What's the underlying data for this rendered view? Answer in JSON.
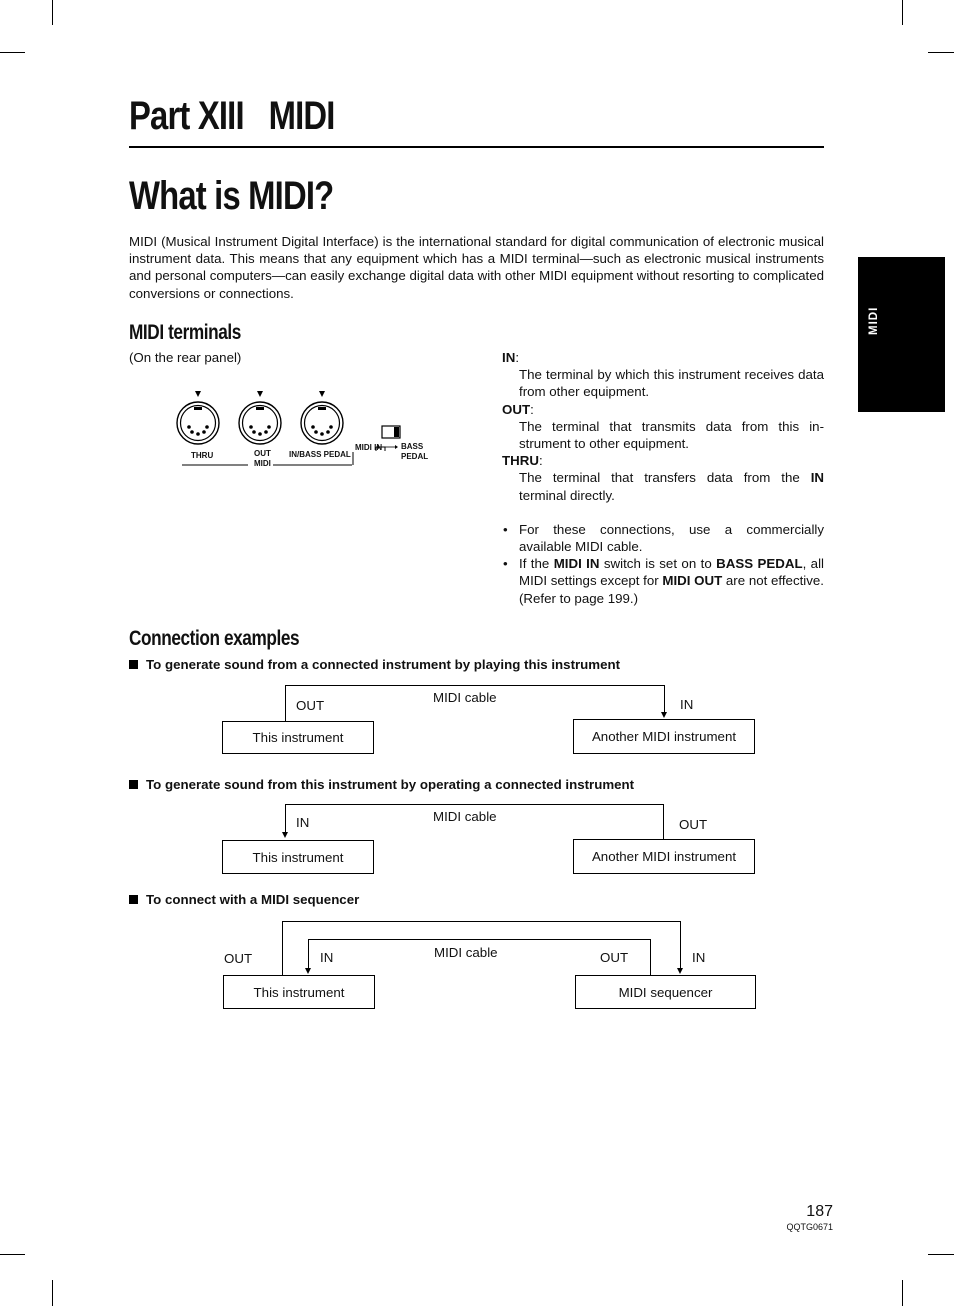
{
  "part_title": "Part XIII   MIDI",
  "page_title": "What is MIDI?",
  "intro": "MIDI (Musical Instrument Digital Interface) is the international standard for digital communication of electronic musical instrument data. This means that any equipment which has a MIDI terminal—such as electronic musical instruments and personal computers—can easily exchange digital data with other MIDI equipment without resorting to complicated conversions or connections.",
  "side_tab": "MIDI",
  "terminals": {
    "heading": "MIDI terminals",
    "caption": "(On the rear panel)",
    "panel": {
      "jack_labels": [
        "THRU",
        "OUT",
        "IN/BASS PEDAL"
      ],
      "group_label": "MIDI",
      "switch_left": "MIDI IN",
      "switch_right_1": "BASS",
      "switch_right_2": "PEDAL"
    },
    "definitions": [
      {
        "term": "IN",
        "text": "The terminal by which this instrument receives data from other equipment."
      },
      {
        "term": "OUT",
        "text": "The terminal that transmits data from this in-strument to other equipment."
      },
      {
        "term": "THRU",
        "text_before": "The terminal that transfers data from the ",
        "bold": "IN",
        "text_after": " terminal directly."
      }
    ],
    "notes": [
      {
        "text": "For these connections, use a commercially available MIDI cable."
      },
      {
        "p1": "If the ",
        "b1": "MIDI IN",
        "p2": " switch is set on to ",
        "b2": "BASS PEDAL",
        "p3": ", all MIDI settings except for ",
        "b3": "MIDI OUT",
        "p4": " are not effective. (Refer to page 199.)"
      }
    ]
  },
  "connections": {
    "heading": "Connection examples",
    "examples": [
      {
        "title": "To generate sound from a connected instrument by playing this instrument",
        "left_box": "This instrument",
        "right_box": "Another MIDI instrument",
        "cable": "MIDI cable",
        "left_port": "OUT",
        "right_port": "IN"
      },
      {
        "title": "To generate sound from this instrument by operating a connected instrument",
        "left_box": "This instrument",
        "right_box": "Another MIDI instrument",
        "cable": "MIDI cable",
        "left_port": "IN",
        "right_port": "OUT"
      },
      {
        "title": "To connect with a MIDI sequencer",
        "left_box": "This instrument",
        "right_box": "MIDI sequencer",
        "cable": "MIDI cable",
        "left_out": "OUT",
        "left_in": "IN",
        "right_out": "OUT",
        "right_in": "IN"
      }
    ]
  },
  "footer": {
    "page_number": "187",
    "code": "QQTG0671"
  }
}
